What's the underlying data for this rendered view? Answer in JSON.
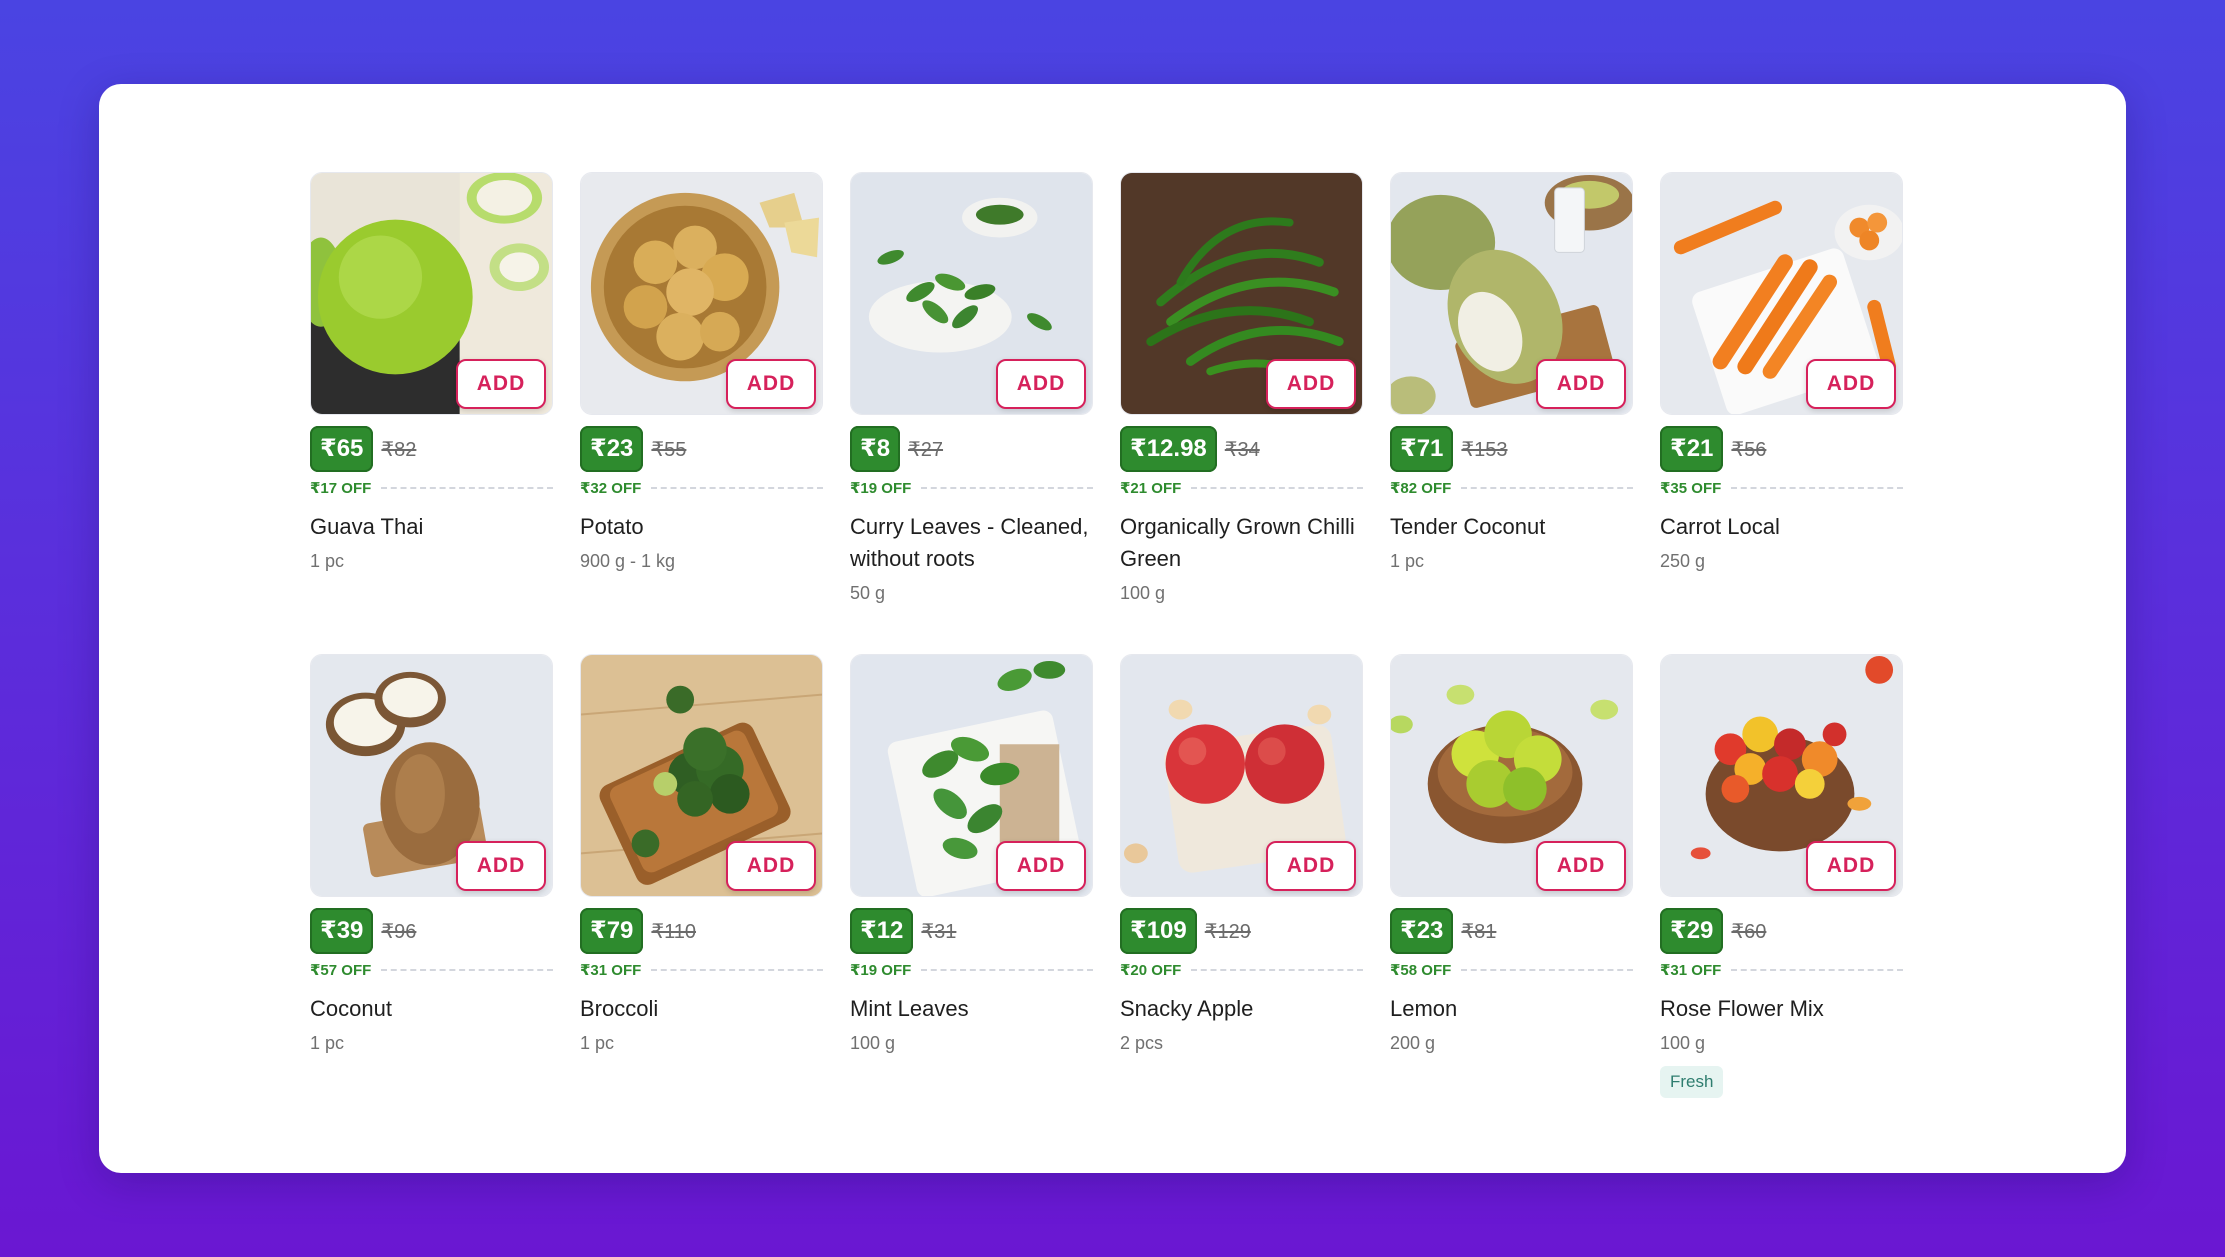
{
  "add_label": "ADD",
  "colors": {
    "accent": "#d6215b",
    "price_bg": "#2e8b2e",
    "off_text": "#2e8b2e"
  },
  "products": [
    {
      "name": "Guava Thai",
      "price": "₹65",
      "mrp": "₹82",
      "off": "₹17 OFF",
      "qty": "1 pc",
      "image": "guava-image"
    },
    {
      "name": "Potato",
      "price": "₹23",
      "mrp": "₹55",
      "off": "₹32 OFF",
      "qty": "900 g - 1 kg",
      "image": "potato-image"
    },
    {
      "name": "Curry Leaves - Cleaned, without roots",
      "price": "₹8",
      "mrp": "₹27",
      "off": "₹19 OFF",
      "qty": "50 g",
      "image": "curry-leaves-image"
    },
    {
      "name": "Organically Grown Chilli Green",
      "price": "₹12.98",
      "mrp": "₹34",
      "off": "₹21 OFF",
      "qty": "100 g",
      "image": "green-chilli-image"
    },
    {
      "name": "Tender Coconut",
      "price": "₹71",
      "mrp": "₹153",
      "off": "₹82 OFF",
      "qty": "1 pc",
      "image": "tender-coconut-image"
    },
    {
      "name": "Carrot Local",
      "price": "₹21",
      "mrp": "₹56",
      "off": "₹35 OFF",
      "qty": "250 g",
      "image": "carrot-image"
    },
    {
      "name": "Coconut",
      "price": "₹39",
      "mrp": "₹96",
      "off": "₹57 OFF",
      "qty": "1 pc",
      "image": "coconut-image"
    },
    {
      "name": "Broccoli",
      "price": "₹79",
      "mrp": "₹110",
      "off": "₹31 OFF",
      "qty": "1 pc",
      "image": "broccoli-image"
    },
    {
      "name": "Mint Leaves",
      "price": "₹12",
      "mrp": "₹31",
      "off": "₹19 OFF",
      "qty": "100 g",
      "image": "mint-leaves-image"
    },
    {
      "name": "Snacky Apple",
      "price": "₹109",
      "mrp": "₹129",
      "off": "₹20 OFF",
      "qty": "2 pcs",
      "image": "apple-image"
    },
    {
      "name": "Lemon",
      "price": "₹23",
      "mrp": "₹81",
      "off": "₹58 OFF",
      "qty": "200 g",
      "image": "lemon-image"
    },
    {
      "name": "Rose Flower Mix",
      "price": "₹29",
      "mrp": "₹60",
      "off": "₹31 OFF",
      "qty": "100 g",
      "tag": "Fresh",
      "image": "rose-flower-image"
    }
  ]
}
